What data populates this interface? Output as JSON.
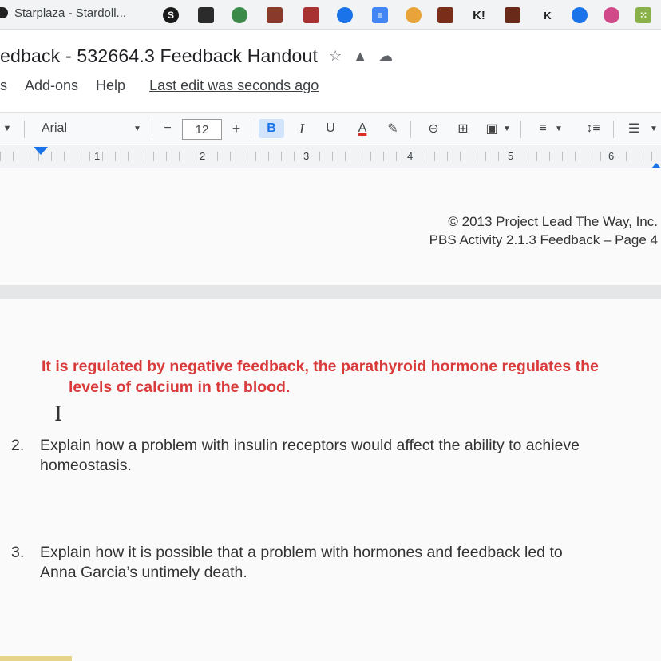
{
  "bookmarks": {
    "first_label": "Starplaza - Stardoll...",
    "icons": [
      "stardoll-icon",
      "bookmark-icon-2",
      "bookmark-icon-3",
      "bookmark-icon-4",
      "bookmark-icon-5",
      "bookmark-icon-6",
      "docs-icon",
      "puzzle-icon",
      "bookmark-icon-9",
      "kahoot-icon",
      "bookmark-icon-11",
      "k-icon",
      "bookmark-icon-13",
      "bookmark-icon-14",
      "grid-icon"
    ],
    "letters": {
      "s": "S",
      "kahoot": "K!",
      "k": "K"
    }
  },
  "document": {
    "title": "edback - 532664.3 Feedback Handout"
  },
  "menu": {
    "items": [
      "s",
      "Add-ons",
      "Help"
    ],
    "last_edit": "Last edit was seconds ago"
  },
  "toolbar": {
    "font": "Arial",
    "font_size": "12",
    "minus": "−",
    "plus": "+",
    "bold": "B",
    "italic": "I",
    "underline": "U",
    "text_color": "A"
  },
  "ruler": {
    "numbers": [
      "1",
      "2",
      "3",
      "4",
      "5",
      "6"
    ]
  },
  "footer": {
    "copyright": "© 2013 Project Lead The Way, Inc.",
    "page_label": "PBS Activity 2.1.3 Feedback – Page 4"
  },
  "content": {
    "answer_line1": "It is regulated by negative feedback, the parathyroid hormone regulates the",
    "answer_line2": "levels of calcium in the blood.",
    "q2_num": "2.",
    "q2_line1": "Explain how a problem with insulin receptors would affect the ability to achieve",
    "q2_line2": "homeostasis.",
    "q3_num": "3.",
    "q3_line1": "Explain how it is possible that a problem with hormones and feedback led to",
    "q3_line2": "Anna Garcia’s untimely death."
  },
  "colors": {
    "answer_red": "#d93a3a",
    "accent_blue": "#1a73e8",
    "bold_active_bg": "#d2e3fc"
  }
}
